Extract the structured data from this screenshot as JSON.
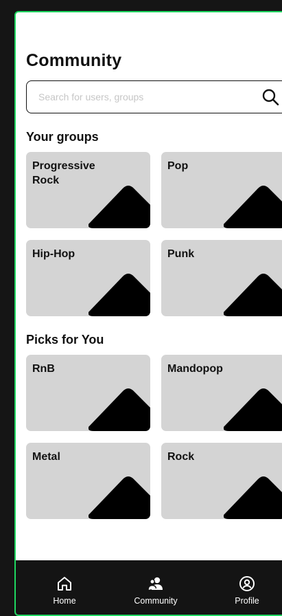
{
  "page": {
    "title": "Community"
  },
  "search": {
    "placeholder": "Search for users, groups",
    "value": ""
  },
  "your_groups": {
    "title": "Your groups",
    "items": [
      {
        "label": "Progressive Rock"
      },
      {
        "label": "Pop"
      },
      {
        "label": "Hip-Hop"
      },
      {
        "label": "Punk"
      }
    ]
  },
  "picks": {
    "title": "Picks for You",
    "items": [
      {
        "label": "RnB"
      },
      {
        "label": "Mandopop"
      },
      {
        "label": "Metal"
      },
      {
        "label": "Rock"
      }
    ]
  },
  "nav": {
    "items": [
      {
        "label": "Home",
        "icon": "home-icon"
      },
      {
        "label": "Community",
        "icon": "community-icon",
        "active": true
      },
      {
        "label": "Profile",
        "icon": "profile-icon"
      }
    ]
  },
  "colors": {
    "accent": "#1ed760",
    "card": "#d4d4d4",
    "nav_background": "#141414",
    "page_background": "#151515"
  }
}
